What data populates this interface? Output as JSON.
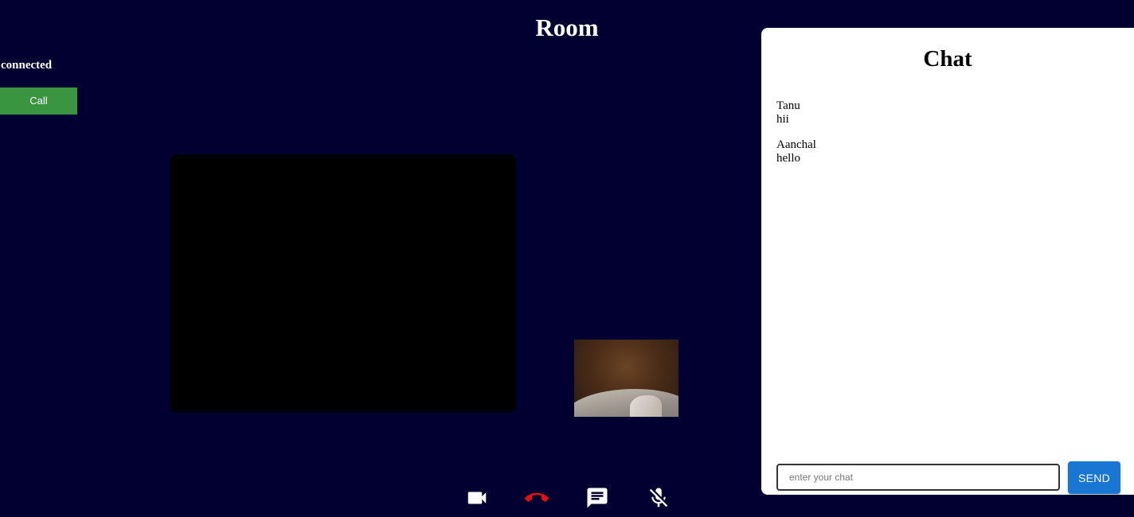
{
  "header": {
    "title": "Room"
  },
  "connection": {
    "status": "connected",
    "call_label": "Call"
  },
  "controls": [
    {
      "icon": "video-camera-icon",
      "color": "#ffffff"
    },
    {
      "icon": "end-call-icon",
      "color": "#e01010"
    },
    {
      "icon": "chat-icon",
      "color": "#ffffff"
    },
    {
      "icon": "mic-off-icon",
      "color": "#ffffff"
    }
  ],
  "chat": {
    "title": "Chat",
    "messages": [
      {
        "sender": "Tanu",
        "text": "hii"
      },
      {
        "sender": "Aanchal",
        "text": "hello"
      }
    ],
    "input_placeholder": "enter your chat",
    "input_value": "",
    "send_label": "SEND"
  },
  "colors": {
    "background": "#010030",
    "call_button": "#3a9540",
    "send_button": "#1976d2",
    "end_call": "#e01010"
  }
}
